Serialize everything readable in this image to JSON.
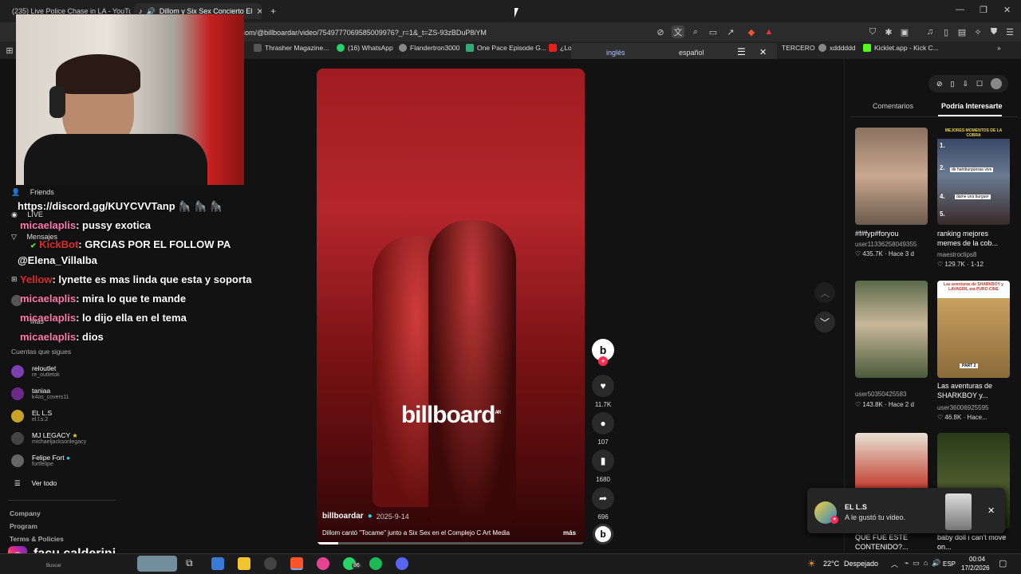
{
  "tabs": [
    {
      "title": "(235) Live Police Chase in LA - YouTu",
      "active": false
    },
    {
      "title": "Dillom y Six Sex Concierto El",
      "active": true
    }
  ],
  "new_tab": "+",
  "window_controls": {
    "minimize": "—",
    "maximize": "❐",
    "close": "✕"
  },
  "url": ".com/@billboardar/video/7549777069585009976?_r=1&_t=ZS-93zBDuP8iYM",
  "bookmarks": [
    "Thrasher Magazine...",
    "(16) WhatsApp",
    "Flandertron3000",
    "One Pace Episode G...",
    "¿Lo",
    "TERCERO",
    "xdddddd",
    "Kicklet.app - Kick C..."
  ],
  "translate": {
    "lang_from": "inglés",
    "lang_to": "español"
  },
  "sidebar_nav": [
    "Friends",
    "LIVE",
    "Mensajes",
    "Más"
  ],
  "chat_lines": [
    {
      "user": "",
      "msg": "https://discord.gg/KUYCVVTanp 🦍 🦍 🦍",
      "user_color": "#ffffff"
    },
    {
      "user": "micaelaplis",
      "msg": ": pussy exotica",
      "user_color": "#ff7ab0"
    },
    {
      "user": "KickBot",
      "msg": ": GRCIAS POR EL FOLLOW PA",
      "user_color": "#e02b2b"
    },
    {
      "user": "",
      "msg": "@Elena_Villalba",
      "user_color": "#ffffff"
    },
    {
      "user": "Yellow",
      "msg": ": lynette es mas linda que esta y soporta",
      "user_color": "#e02b2b"
    },
    {
      "user": "micaelaplis",
      "msg": ": mira lo que te mande",
      "user_color": "#ff7ab0"
    },
    {
      "user": "micaelaplis",
      "msg": ": lo dijo ella en el tema",
      "user_color": "#ff7ab0"
    },
    {
      "user": "micaelaplis",
      "msg": ": dios",
      "user_color": "#ff7ab0"
    }
  ],
  "following_header": "Cuentas que sigues",
  "following": [
    {
      "name": "reloutlet",
      "handle": "re_outletok",
      "color": "#7a3fb0"
    },
    {
      "name": "taniaa",
      "handle": "k4os_covers11",
      "color": "#6b2a8a"
    },
    {
      "name": "EL L.S",
      "handle": "el.l.s.2",
      "color": "#c9a22a"
    },
    {
      "name": "MJ LEGACY",
      "handle": "michaeljacksonlegacy",
      "color": "#444"
    },
    {
      "name": "Felipe Fort",
      "handle": "fortfelipe",
      "color": "#666"
    }
  ],
  "see_all": "Ver todo",
  "footer_links": [
    "Company",
    "Program",
    "Terms & Policies"
  ],
  "streamer": {
    "name": "facu.calderini"
  },
  "video": {
    "watermark": "billboard",
    "watermark_sub": "AR",
    "author": "billboardar",
    "date": "2025-9-14",
    "caption": "Dillom cantó \"Tocame\" junto a Six Sex en el Complejo C Art Media",
    "more": "más",
    "likes": "11.7K",
    "comments": "107",
    "saves": "1680",
    "shares": "696"
  },
  "right_tabs": {
    "comments": "Comentarios",
    "interesting": "Podría Interesarte"
  },
  "recommendations": [
    {
      "title": "#f#fyp#foryou",
      "user": "user11336258049355",
      "likes": "435.7K",
      "ago": "Hace 3 d"
    },
    {
      "title": "ranking mejores memes de la cob...",
      "user": "maestroclips8",
      "likes": "129.7K",
      "ago": "1-12"
    },
    {
      "title": "",
      "user": "user50350425583",
      "likes": "143.8K",
      "ago": "Hace 2 d"
    },
    {
      "title": "Las aventuras de SHARKBOY y...",
      "user": "user36006925595",
      "likes": "46.8K",
      "ago": "Hace..."
    },
    {
      "title": "QUE FUE ESTE CONTENIDO?...",
      "user": "",
      "likes": "",
      "ago": ""
    },
    {
      "title": "baby doll i can't move on...",
      "user": "",
      "likes": "",
      "ago": ""
    }
  ],
  "thumb_text": {
    "ranking_header": "MEJORES MOMENTOS DE LA COBRA",
    "ranking_items": [
      "1.",
      "2.",
      "4.",
      "5."
    ],
    "ranking_subs": [
      "de hamburguesas vive",
      "dame una burguer"
    ],
    "shark_header": "Las aventuras de SHARKBOY y LAVAGIRL era PURO CINE",
    "shark_part": "PART 2"
  },
  "toast": {
    "user": "EL L.S",
    "message": "A le gustó tu video."
  },
  "taskbar": {
    "search": "Buscar",
    "weather_temp": "22°C",
    "weather_desc": "Despejado",
    "lang": "ESP",
    "time": "00:04",
    "date": "17/2/2026",
    "whatsapp_badge": "86"
  }
}
